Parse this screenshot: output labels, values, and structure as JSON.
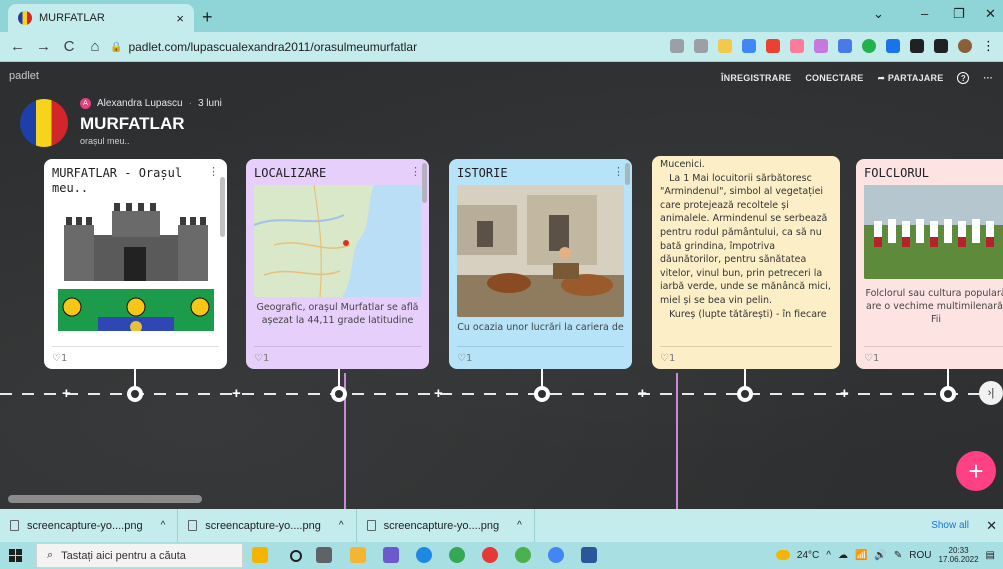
{
  "browser": {
    "tab_title": "MURFATLAR",
    "tab_close": "×",
    "new_tab": "+",
    "url": "padlet.com/lupascualexandra2011/orasulmeumurfatlar",
    "window_controls": [
      "⌄",
      "–",
      "❐",
      "✕"
    ]
  },
  "padlet": {
    "brand": "padlet",
    "menu": [
      "ÎNREGISTRARE",
      "CONECTARE",
      "➦ PARTAJARE"
    ],
    "help": "?",
    "more": "···",
    "author_initial": "A",
    "author": "Alexandra Lupascu",
    "age": "3 luni",
    "title": "MURFATLAR",
    "subtitle": "orașul meu..",
    "cards": [
      {
        "title": "MURFATLAR - Orașul meu..",
        "likes": "♡1"
      },
      {
        "title": "LOCALIZARE",
        "text": "Geografic, orașul Murfatlar se află așezat la 44,11 grade latitudine",
        "likes": "♡1"
      },
      {
        "title": "ISTORIE",
        "text": "Cu ocazia unor lucrări la cariera de",
        "likes": "♡1"
      },
      {
        "title": "",
        "text_lines": [
          "Mucenici.",
          "   La 1 Mai locuitorii sărbătoresc \"Armindenul\", simbol al vegetației care protejează recoltele și animalele. Armindenul se serbează pentru rodul pământului, ca să nu bată grindina, împotriva dăunătorilor, pentru sănătatea vitelor, vinul bun, prin petreceri la iarbă verde, unde se mănâncă mici, miel și se bea vin pelin.",
          "   Kureș (lupte tătărești) - în fiecare"
        ],
        "likes": "♡1"
      },
      {
        "title": "FOLCLORUL",
        "text": "Folclorul sau cultura populară are o vechime multimilenară. Fii",
        "likes": "♡1"
      }
    ],
    "next": "›|",
    "fab": "+"
  },
  "downloads": {
    "items": [
      "screencapture-yo....png",
      "screencapture-yo....png",
      "screencapture-yo....png"
    ],
    "show_all": "Show all",
    "close": "✕"
  },
  "taskbar": {
    "search_placeholder": "Tastați aici pentru a căuta",
    "weather": "24°C",
    "lang": "ROU",
    "time": "20:33",
    "date": "17.06.2022"
  }
}
